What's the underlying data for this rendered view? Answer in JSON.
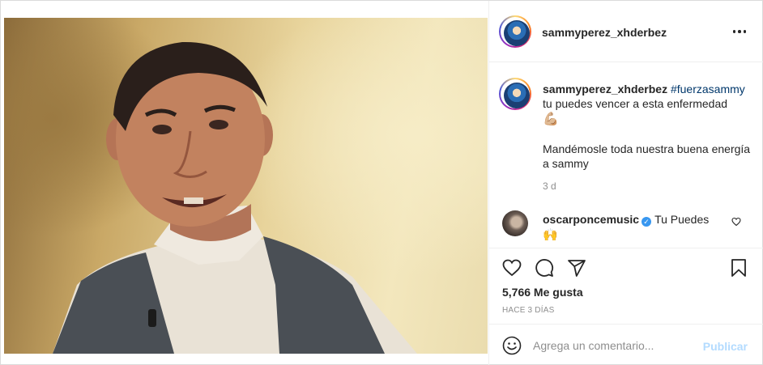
{
  "post": {
    "username": "sammyperez_xhderbez",
    "more_icon": "more-horizontal-icon"
  },
  "caption": {
    "username": "sammyperez_xhderbez",
    "hashtag": "#fuerzasammy",
    "line1": "tu puedes vencer a esta enfermedad",
    "emoji": "💪🏼",
    "paragraph2": "Mandémosle toda nuestra buena energía a sammy",
    "time": "3 d"
  },
  "comment": {
    "username": "oscarponcemusic",
    "verified_icon": "verified-badge-icon",
    "text": "Tu Puedes",
    "emoji": "🙌"
  },
  "actions": {
    "likes": "5,766 Me gusta",
    "posted": "HACE 3 DÍAS"
  },
  "add_comment": {
    "placeholder": "Agrega un comentario...",
    "publish_label": "Publicar"
  }
}
